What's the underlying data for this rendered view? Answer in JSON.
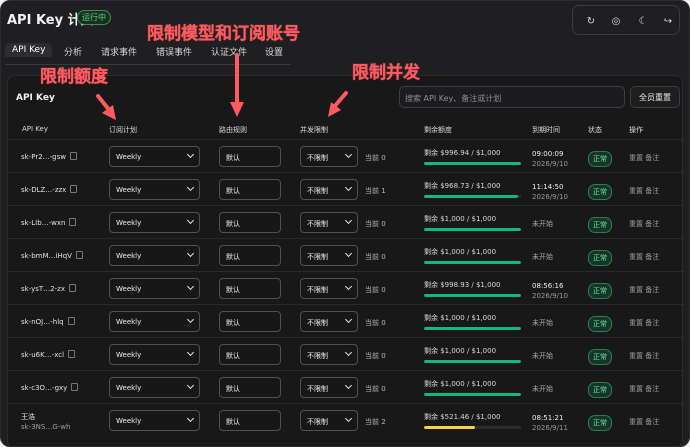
{
  "app": {
    "title": "API Key 计费",
    "status": "运行中"
  },
  "tabs": [
    {
      "label": "API Key"
    },
    {
      "label": "分析"
    },
    {
      "label": "请求事件"
    },
    {
      "label": "错误事件"
    },
    {
      "label": "认证文件"
    },
    {
      "label": "设置"
    }
  ],
  "panel": {
    "title": "API Key",
    "search_placeholder": "搜索 API Key、备注或计划",
    "reset_all": "全员重置"
  },
  "headers": {
    "key": "API Key",
    "plan": "订阅计划",
    "route": "路由规则",
    "concurrency": "并发限制",
    "quota": "剩余额度",
    "expiry": "到期时间",
    "status": "状态",
    "ops": "操作"
  },
  "annotations": {
    "limit_quota": "限制额度",
    "limit_model_sub": "限制模型和订阅账号",
    "limit_concurrency": "限制并发"
  },
  "rows": [
    {
      "key": "sk-Pr2…-gsw",
      "plan": "Weekly",
      "route": "默认",
      "concurrency": "不限制",
      "current": "当前 0",
      "quota": "剩余 $996.94 / $1,000",
      "remaining_fraction": 0.997,
      "expiry_time": "09:00:09",
      "expiry_date": "2026/9/10",
      "status": "正常",
      "reset": "重置",
      "note": "备注"
    },
    {
      "key": "sk-DLZ…-zzx",
      "plan": "Weekly",
      "route": "默认",
      "concurrency": "不限制",
      "current": "当前 1",
      "quota": "剩余 $968.73 / $1,000",
      "remaining_fraction": 0.969,
      "expiry_time": "11:14:50",
      "expiry_date": "2026/9/10",
      "status": "正常",
      "reset": "重置",
      "note": "备注"
    },
    {
      "key": "sk-LIb…-wxn",
      "plan": "Weekly",
      "route": "默认",
      "concurrency": "不限制",
      "current": "当前 0",
      "quota": "剩余 $1,000 / $1,000",
      "remaining_fraction": 1,
      "expiry_text": "未开始",
      "status": "正常",
      "reset": "重置",
      "note": "备注"
    },
    {
      "key": "sk-bmM…iHqV",
      "plan": "Weekly",
      "route": "默认",
      "concurrency": "不限制",
      "current": "当前 0",
      "quota": "剩余 $1,000 / $1,000",
      "remaining_fraction": 1,
      "expiry_text": "未开始",
      "status": "正常",
      "reset": "重置",
      "note": "备注"
    },
    {
      "key": "sk-ysT…2-zx",
      "plan": "Weekly",
      "route": "默认",
      "concurrency": "不限制",
      "current": "当前 0",
      "quota": "剩余 $998.93 / $1,000",
      "remaining_fraction": 0.999,
      "expiry_time": "08:56:16",
      "expiry_date": "2026/9/10",
      "status": "正常",
      "reset": "重置",
      "note": "备注"
    },
    {
      "key": "sk-nOJ…-hlq",
      "plan": "Weekly",
      "route": "默认",
      "concurrency": "不限制",
      "current": "当前 0",
      "quota": "剩余 $1,000 / $1,000",
      "remaining_fraction": 1,
      "expiry_text": "未开始",
      "status": "正常",
      "reset": "重置",
      "note": "备注"
    },
    {
      "key": "sk-u6K…-xcl",
      "plan": "Weekly",
      "route": "默认",
      "concurrency": "不限制",
      "current": "当前 0",
      "quota": "剩余 $1,000 / $1,000",
      "remaining_fraction": 1,
      "expiry_text": "未开始",
      "status": "正常",
      "reset": "重置",
      "note": "备注"
    },
    {
      "key": "sk-c3O…-gxy",
      "plan": "Weekly",
      "route": "默认",
      "concurrency": "不限制",
      "current": "当前 0",
      "quota": "剩余 $1,000 / $1,000",
      "remaining_fraction": 1,
      "expiry_text": "未开始",
      "status": "正常",
      "reset": "重置",
      "note": "备注"
    },
    {
      "name": "王浩",
      "key": "sk-3NS…G-wh",
      "plan": "Weekly",
      "route": "默认",
      "concurrency": "不限制",
      "current": "当前 2",
      "quota": "剩余 $521.46 / $1,000",
      "remaining_fraction": 0.521,
      "expiry_time": "08:51:21",
      "expiry_date": "2026/9/11",
      "status": "正常",
      "reset": "重置",
      "note": "备注"
    }
  ],
  "colors": {
    "accent_green": "#10b981",
    "warning_yellow": "#f5d44b",
    "annotation_red": "#ff5a5f"
  },
  "icons": [
    "refresh-icon",
    "globe-icon",
    "moon-icon",
    "logout-icon",
    "copy-icon",
    "chevron-down-icon"
  ]
}
